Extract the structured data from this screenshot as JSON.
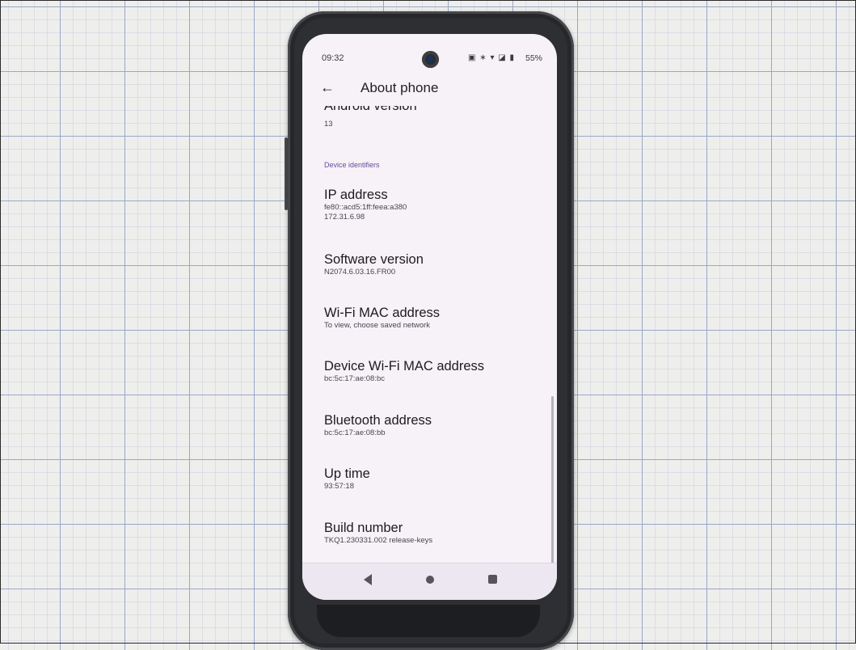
{
  "status_bar": {
    "time": "09:32",
    "battery": "55%"
  },
  "app_bar": {
    "title": "About phone"
  },
  "partial_item": {
    "title": "Android version",
    "value": "13"
  },
  "section_header": "Device identifiers",
  "items": [
    {
      "title": "IP address",
      "lines": [
        "fe80::acd5:1ff:feea:a380",
        "172.31.6.98"
      ]
    },
    {
      "title": "Software version",
      "lines": [
        "N2074.6.03.16.FR00"
      ]
    },
    {
      "title": "Wi-Fi MAC address",
      "lines": [
        "To view, choose saved network"
      ]
    },
    {
      "title": "Device Wi-Fi MAC address",
      "lines": [
        "bc:5c:17:ae:08:bc"
      ]
    },
    {
      "title": "Bluetooth address",
      "lines": [
        "bc:5c:17:ae:08:bb"
      ]
    },
    {
      "title": "Up time",
      "lines": [
        "93:57:18"
      ]
    },
    {
      "title": "Build number",
      "lines": [
        "TKQ1.230331.002 release-keys"
      ]
    }
  ],
  "colors": {
    "screen_bg": "#f6f2f7",
    "section_header": "#6a4aa0",
    "phone_body": "#2e2f33",
    "grid_paper": "#eeeeec"
  },
  "icons": {
    "back": "arrow-left-icon",
    "nav_back": "triangle-back-icon",
    "nav_home": "circle-home-icon",
    "nav_recents": "square-recents-icon"
  }
}
